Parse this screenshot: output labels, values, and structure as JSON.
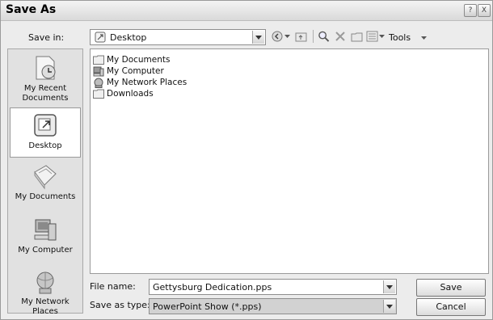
{
  "window": {
    "title": "Save As",
    "help_btn": "?",
    "close_btn": "X"
  },
  "toolbar": {
    "save_in_label": "Save in:",
    "save_in_value": "Desktop",
    "tools_label": "Tools"
  },
  "places": [
    {
      "label": "My Recent Documents",
      "icon": "recent-documents-icon"
    },
    {
      "label": "Desktop",
      "icon": "desktop-icon"
    },
    {
      "label": "My Documents",
      "icon": "my-documents-icon"
    },
    {
      "label": "My Computer",
      "icon": "my-computer-icon"
    },
    {
      "label": "My Network Places",
      "icon": "network-places-icon"
    }
  ],
  "files": [
    {
      "name": "My Documents",
      "icon": "folder-icon"
    },
    {
      "name": "My Computer",
      "icon": "computer-icon"
    },
    {
      "name": "My Network Places",
      "icon": "network-icon"
    },
    {
      "name": "Downloads",
      "icon": "folder-icon"
    }
  ],
  "form": {
    "file_name_label": "File name:",
    "file_name_value": "Gettysburg Dedication.pps",
    "save_type_label": "Save as type:",
    "save_type_value": "PowerPoint Show (*.pps)"
  },
  "buttons": {
    "save": "Save",
    "cancel": "Cancel"
  }
}
